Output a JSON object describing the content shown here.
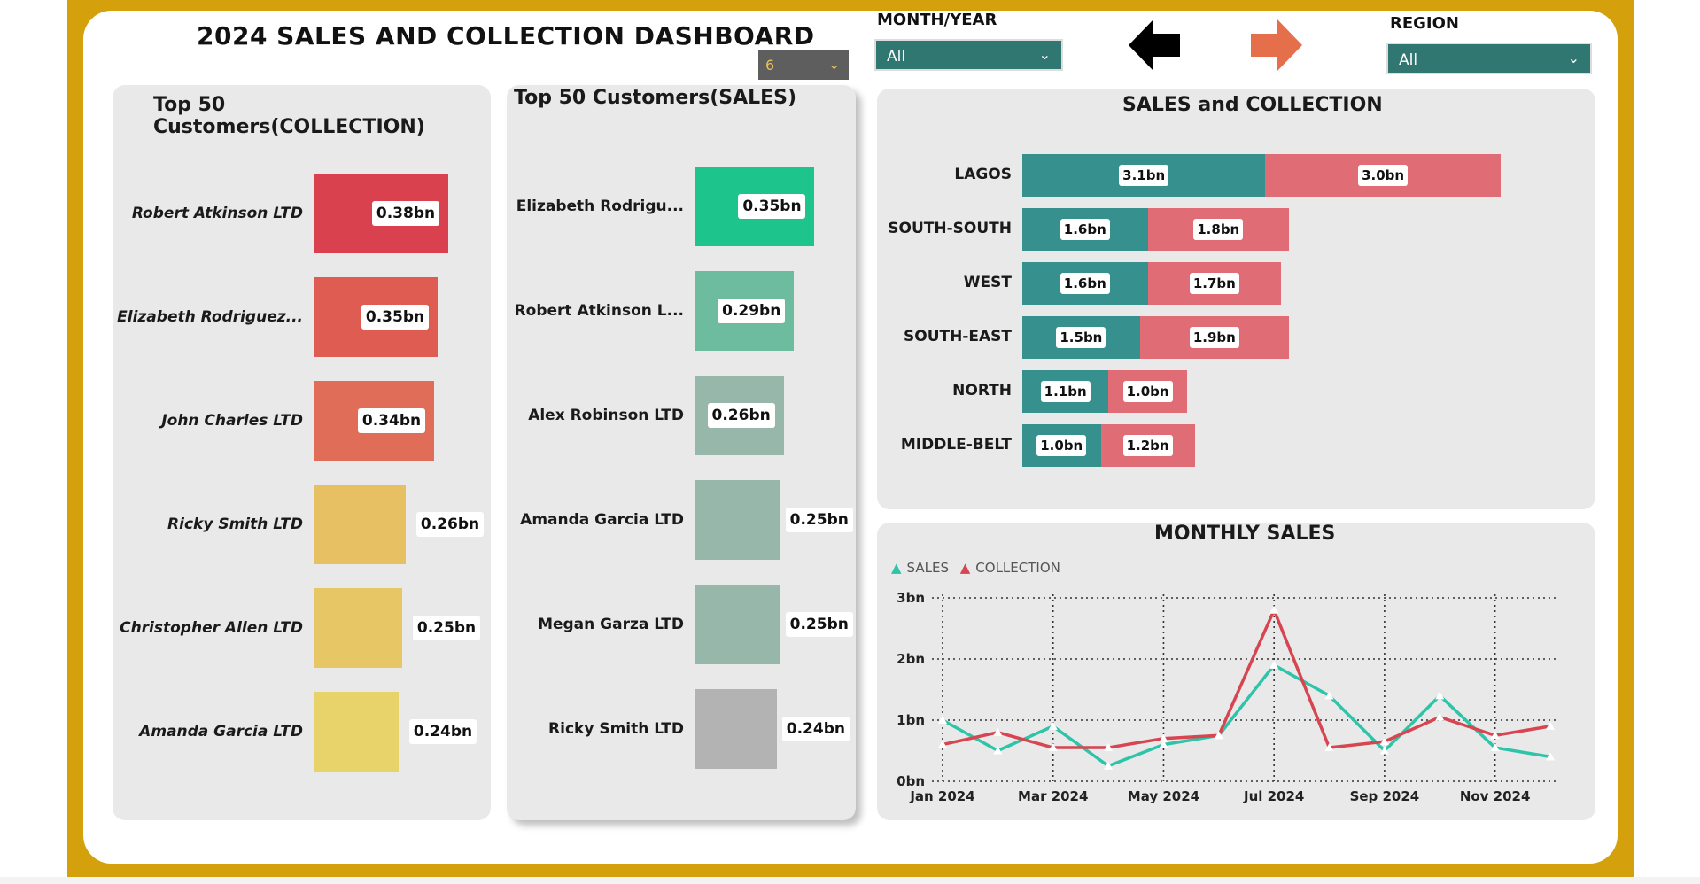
{
  "dashboard": {
    "title": "2024 SALES AND COLLECTION DASHBOARD"
  },
  "topn_select": {
    "value": "6"
  },
  "filters": {
    "month_year": {
      "label": "MONTH/YEAR",
      "value": "All"
    },
    "region": {
      "label": "REGION",
      "value": "All"
    }
  },
  "colors": {
    "teal": "#35908e",
    "pink": "#e06c75",
    "sales_line": "#2ec4a9",
    "collection_line": "#d64550"
  },
  "collection_chart": {
    "title": "Top 50 Customers(COLLECTION)",
    "type": "bar",
    "items": [
      {
        "name": "Robert Atkinson LTD",
        "value": 0.38,
        "label": "0.38bn",
        "color": "#d9414e"
      },
      {
        "name": "Elizabeth Rodriguez...",
        "value": 0.35,
        "label": "0.35bn",
        "color": "#de5c52"
      },
      {
        "name": "John Charles LTD",
        "value": 0.34,
        "label": "0.34bn",
        "color": "#e06d57"
      },
      {
        "name": "Ricky Smith LTD",
        "value": 0.26,
        "label": "0.26bn",
        "color": "#e6c062"
      },
      {
        "name": "Christopher Allen LTD",
        "value": 0.25,
        "label": "0.25bn",
        "color": "#e7c665"
      },
      {
        "name": "Amanda Garcia LTD",
        "value": 0.24,
        "label": "0.24bn",
        "color": "#e8d36a"
      }
    ]
  },
  "sales_chart": {
    "title": "Top 50 Customers(SALES)",
    "type": "bar",
    "items": [
      {
        "name": "Elizabeth Rodrigu...",
        "value": 0.35,
        "label": "0.35bn",
        "color": "#1dc48b"
      },
      {
        "name": "Robert Atkinson L...",
        "value": 0.29,
        "label": "0.29bn",
        "color": "#6dbca0"
      },
      {
        "name": "Alex Robinson LTD",
        "value": 0.26,
        "label": "0.26bn",
        "color": "#98b7ab"
      },
      {
        "name": "Amanda Garcia LTD",
        "value": 0.25,
        "label": "0.25bn",
        "color": "#98b7ab"
      },
      {
        "name": "Megan Garza LTD",
        "value": 0.25,
        "label": "0.25bn",
        "color": "#98b7ab"
      },
      {
        "name": "Ricky Smith LTD",
        "value": 0.24,
        "label": "0.24bn",
        "color": "#b3b3b3"
      }
    ]
  },
  "chart_data": [
    {
      "type": "bar",
      "title": "SALES and COLLECTION",
      "categories": [
        "LAGOS",
        "SOUTH-SOUTH",
        "WEST",
        "SOUTH-EAST",
        "NORTH",
        "MIDDLE-BELT"
      ],
      "series": [
        {
          "values": [
            3.1,
            1.6,
            1.6,
            1.5,
            1.1,
            1.0
          ],
          "labels": [
            "3.1bn",
            "1.6bn",
            "1.6bn",
            "1.5bn",
            "1.1bn",
            "1.0bn"
          ]
        },
        {
          "values": [
            3.0,
            1.8,
            1.7,
            1.9,
            1.0,
            1.2
          ],
          "labels": [
            "3.0bn",
            "1.8bn",
            "1.7bn",
            "1.9bn",
            "1.0bn",
            "1.2bn"
          ]
        }
      ]
    },
    {
      "type": "line",
      "title": "MONTHLY SALES",
      "legend": [
        "SALES",
        "COLLECTION"
      ],
      "ylim": [
        0,
        3
      ],
      "y_ticks": [
        "0bn",
        "1bn",
        "2bn",
        "3bn"
      ],
      "x_ticks": [
        "Jan 2024",
        "Mar 2024",
        "May 2024",
        "Jul 2024",
        "Sep 2024",
        "Nov 2024"
      ],
      "x": [
        "Jan 2024",
        "Feb 2024",
        "Mar 2024",
        "Apr 2024",
        "May 2024",
        "Jun 2024",
        "Jul 2024",
        "Aug 2024",
        "Sep 2024",
        "Oct 2024",
        "Nov 2024",
        "Dec 2024"
      ],
      "series": [
        {
          "name": "SALES",
          "values": [
            1.0,
            0.5,
            0.9,
            0.25,
            0.6,
            0.75,
            1.9,
            1.4,
            0.5,
            1.4,
            0.55,
            0.4
          ]
        },
        {
          "name": "COLLECTION",
          "values": [
            0.6,
            0.8,
            0.55,
            0.55,
            0.7,
            0.75,
            2.8,
            0.55,
            0.65,
            1.05,
            0.75,
            0.9
          ]
        }
      ]
    }
  ]
}
